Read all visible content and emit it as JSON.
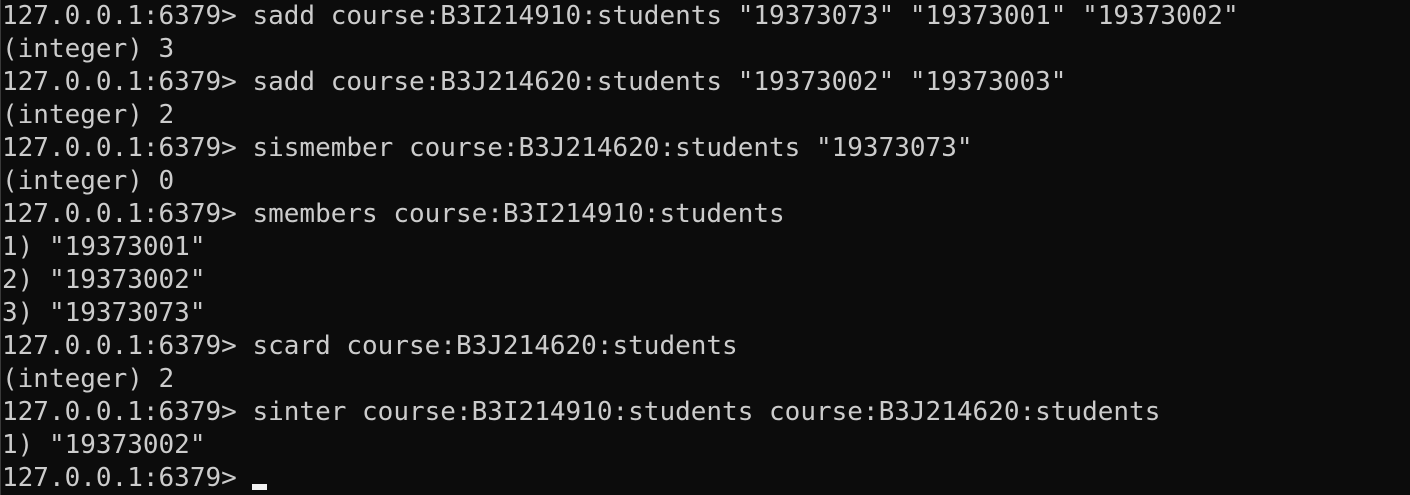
{
  "terminal": {
    "lines": [
      "127.0.0.1:6379> sadd course:B3I214910:students \"19373073\" \"19373001\" \"19373002\"",
      "(integer) 3",
      "127.0.0.1:6379> sadd course:B3J214620:students \"19373002\" \"19373003\"",
      "(integer) 2",
      "127.0.0.1:6379> sismember course:B3J214620:students \"19373073\"",
      "(integer) 0",
      "127.0.0.1:6379> smembers course:B3I214910:students",
      "1) \"19373001\"",
      "2) \"19373002\"",
      "3) \"19373073\"",
      "127.0.0.1:6379> scard course:B3J214620:students",
      "(integer) 2",
      "127.0.0.1:6379> sinter course:B3I214910:students course:B3J214620:students",
      "1) \"19373002\"",
      "127.0.0.1:6379>"
    ],
    "colors": {
      "background": "#0c0c0c",
      "text": "#cccccc",
      "cursor": "#f2f2f2"
    }
  }
}
